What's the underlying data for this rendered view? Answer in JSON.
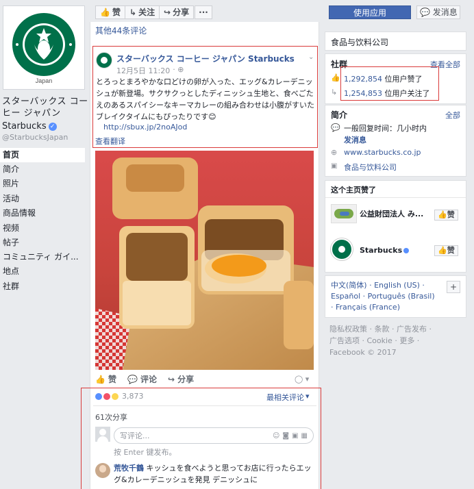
{
  "topbar": {
    "like_label": "赞",
    "follow_label": "关注",
    "share_label": "分享",
    "more_label": "···",
    "use_app_label": "使用应用",
    "send_message_label": "发消息"
  },
  "profile": {
    "logo_caption": "Japan",
    "name": "スターバックス コーヒー ジャパン",
    "brand": "Starbucks",
    "handle": "@StarbucksJapan"
  },
  "nav": {
    "items": [
      "首页",
      "简介",
      "照片",
      "活动",
      "商品情報",
      "视频",
      "帖子",
      "コミュニティ ガイ...",
      "地点",
      "社群"
    ]
  },
  "feed": {
    "more_comments": "其他44条评论",
    "post": {
      "author": "スターバックス コーヒー ジャパン Starbucks",
      "date": "12月5日 11:20",
      "text": "とろっとまろやかな口どけの卵が入った、エッグ&カレーデニッシュが新登場。サクサクっとしたディニッシュ生地と、食べごたえのあるスパイシーなキーマカレーの組み合わせは小腹がすいたブレイクタイムにもぴったりです",
      "link": "http://sbux.jp/2noAJod",
      "translate": "查看翻译"
    },
    "actions": {
      "like": "赞",
      "comment": "评论",
      "share": "分享"
    },
    "reactions_count": "3,873",
    "sort_label": "最相关评论",
    "shares": "61次分享",
    "comment_placeholder": "写评论...",
    "enter_hint": "按 Enter 键发布。",
    "first_comment": {
      "author": "荒牧千鶴",
      "text": "キッシュを食べようと思ってお店に行ったらエッグ&カレーデニッシュを発見 デニッシュに"
    }
  },
  "right": {
    "category": "食品与饮料公司",
    "community": {
      "title": "社群",
      "see_all": "查看全部",
      "likes": "1,292,854",
      "likes_suffix": "位用户赞了",
      "follows": "1,254,853",
      "follows_suffix": "位用户关注了"
    },
    "about": {
      "title": "简介",
      "see_all": "全部",
      "response": "一般回复时间：几小时内",
      "send_msg": "发消息",
      "website": "www.starbucks.co.jp",
      "category": "食品与饮料公司"
    },
    "liked_pages": {
      "title": "这个主页赞了",
      "items": [
        {
          "name": "公益財団法人 み...",
          "btn": "赞"
        },
        {
          "name": "Starbucks",
          "btn": "赞"
        }
      ]
    },
    "languages": {
      "line1": "中文(简体) · English (US) ·",
      "line2": "Español · Português (Brasil)",
      "line3": "· Français (France)",
      "add": "+"
    },
    "footer": {
      "line1": "隐私权政策 · 条款 · 广告发布 ·",
      "line2": "广告选项 · Cookie · 更多 ·",
      "line3": "Facebook © 2017"
    }
  },
  "colors": {
    "fb_blue": "#4267b2",
    "starbucks_green": "#00704a",
    "highlight_red": "#d93a3a"
  }
}
